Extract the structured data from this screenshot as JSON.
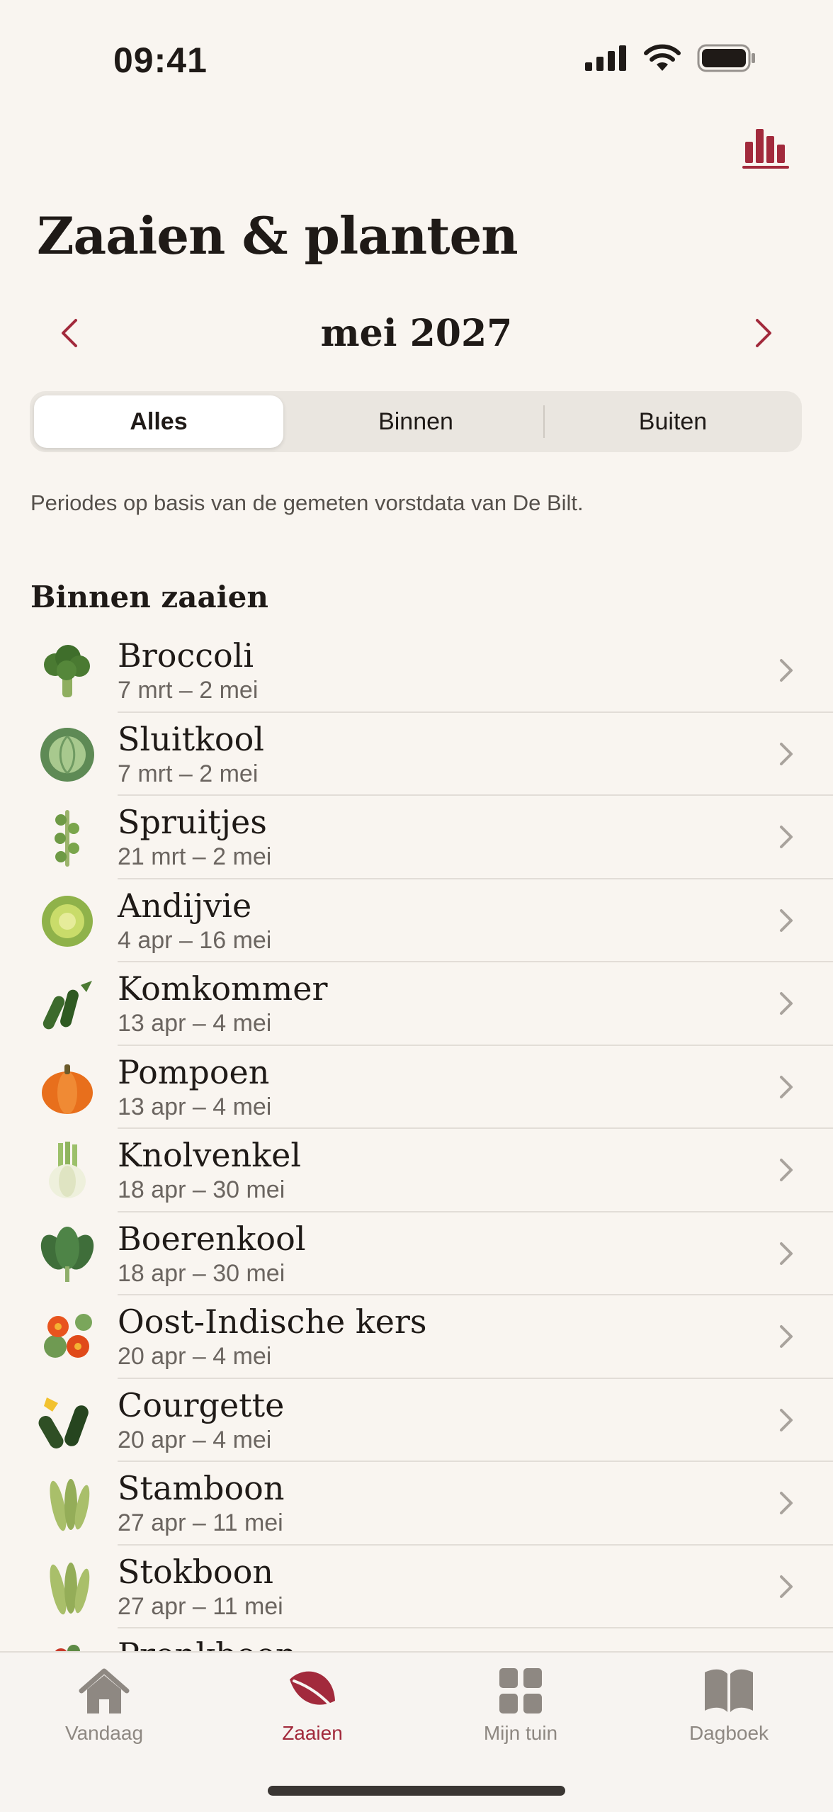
{
  "status_bar": {
    "time": "09:41"
  },
  "header": {
    "title": "Zaaien & planten",
    "stats_icon": "bar-chart-icon"
  },
  "month_nav": {
    "label": "mei 2027"
  },
  "segments": [
    "Alles",
    "Binnen",
    "Buiten"
  ],
  "selected_segment": "Alles",
  "note": "Periodes op basis van de gemeten vorstdata van De Bilt.",
  "section": {
    "title": "Binnen zaaien"
  },
  "plants": [
    {
      "name": "Broccoli",
      "range": "7 mrt – 2 mei",
      "icon": "broccoli-icon"
    },
    {
      "name": "Sluitkool",
      "range": "7 mrt – 2 mei",
      "icon": "cabbage-icon"
    },
    {
      "name": "Spruitjes",
      "range": "21 mrt – 2 mei",
      "icon": "brussels-sprouts-icon"
    },
    {
      "name": "Andijvie",
      "range": "4 apr – 16 mei",
      "icon": "endive-icon"
    },
    {
      "name": "Komkommer",
      "range": "13 apr – 4 mei",
      "icon": "cucumber-icon"
    },
    {
      "name": "Pompoen",
      "range": "13 apr – 4 mei",
      "icon": "pumpkin-icon"
    },
    {
      "name": "Knolvenkel",
      "range": "18 apr – 30 mei",
      "icon": "fennel-icon"
    },
    {
      "name": "Boerenkool",
      "range": "18 apr – 30 mei",
      "icon": "kale-icon"
    },
    {
      "name": "Oost-Indische kers",
      "range": "20 apr – 4 mei",
      "icon": "nasturtium-icon"
    },
    {
      "name": "Courgette",
      "range": "20 apr – 4 mei",
      "icon": "zucchini-icon"
    },
    {
      "name": "Stamboon",
      "range": "27 apr – 11 mei",
      "icon": "bush-bean-icon"
    },
    {
      "name": "Stokboon",
      "range": "27 apr – 11 mei",
      "icon": "pole-bean-icon"
    },
    {
      "name": "Pronkboon",
      "range": "",
      "icon": "runner-bean-icon"
    }
  ],
  "tabs": [
    {
      "label": "Vandaag",
      "icon": "house-icon"
    },
    {
      "label": "Zaaien",
      "icon": "leaf-icon"
    },
    {
      "label": "Mijn tuin",
      "icon": "grid-icon"
    },
    {
      "label": "Dagboek",
      "icon": "book-icon"
    }
  ],
  "active_tab": "Zaaien",
  "colors": {
    "accent": "#a22a3c",
    "background": "#f9f5f0",
    "inactive": "#8e8882"
  }
}
